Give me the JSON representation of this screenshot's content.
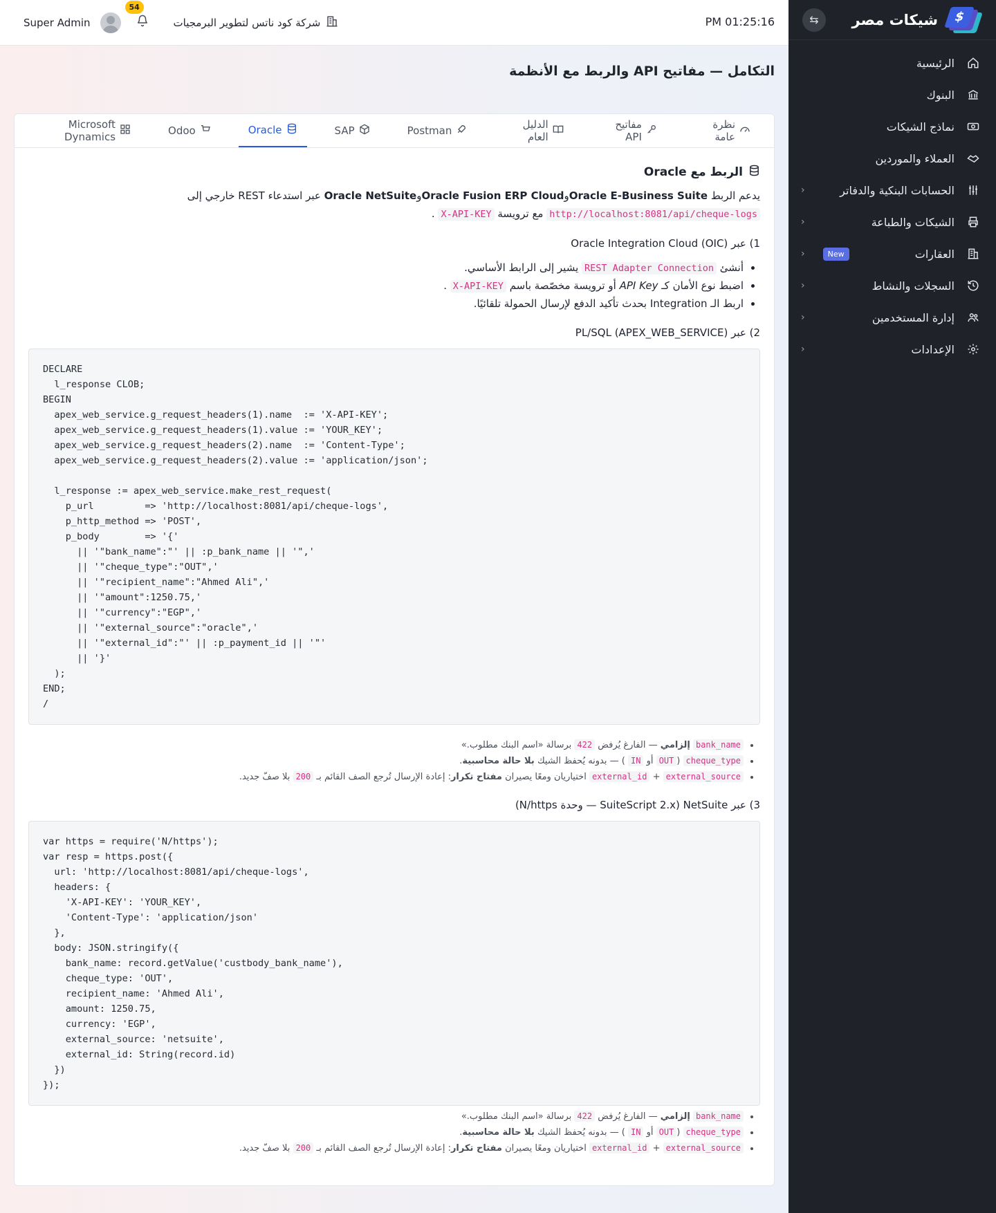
{
  "sidebar": {
    "brand": "شيكات مصر",
    "logo_glyph": "$",
    "items": [
      {
        "label": "الرئيسية",
        "icon": "home-icon"
      },
      {
        "label": "البنوك",
        "icon": "bank-icon"
      },
      {
        "label": "نماذج الشيكات",
        "icon": "cheque-icon"
      },
      {
        "label": "العملاء والموردين",
        "icon": "handshake-icon"
      },
      {
        "label": "الحسابات البنكية والدفاتر",
        "icon": "sliders-icon"
      },
      {
        "label": "الشيكات والطباعة",
        "icon": "printer-icon"
      },
      {
        "label": "العقارات",
        "icon": "building-icon",
        "badge": "New"
      },
      {
        "label": "السجلات والنشاط",
        "icon": "history-icon"
      },
      {
        "label": "إدارة المستخدمين",
        "icon": "users-icon"
      },
      {
        "label": "الإعدادات",
        "icon": "gear-icon"
      }
    ]
  },
  "topbar": {
    "time": "PM 01:25:16",
    "company": "شركة كود ناتس لتطوير البرمجيات",
    "notifications": "54",
    "user": "Super Admin"
  },
  "page": {
    "title": "التكامل — مفاتيح API والربط مع الأنظمة"
  },
  "tabs": [
    {
      "label": "نظرة عامة",
      "icon": "gauge-icon"
    },
    {
      "label": "مفاتيح API",
      "icon": "key-icon"
    },
    {
      "label": "الدليل العام",
      "icon": "book-icon"
    },
    {
      "label": "Postman",
      "icon": "rocket-icon"
    },
    {
      "label": "SAP",
      "icon": "box-icon"
    },
    {
      "label": "Oracle",
      "icon": "database-icon",
      "active": true
    },
    {
      "label": "Odoo",
      "icon": "cart-icon"
    },
    {
      "label": "Microsoft Dynamics",
      "icon": "grid-icon"
    }
  ],
  "oracle": {
    "title": "الربط مع Oracle",
    "intro_prefix": "يدعم الربط",
    "ebs": "Oracle E-Business Suite",
    "and1": "و",
    "fusion": "Oracle Fusion ERP Cloud",
    "and2": "و",
    "netsuite": "Oracle NetSuite",
    "intro_mid": "عبر استدعاء REST خارجي إلى",
    "endpoint": "http://localhost:8081/api/cheque-logs",
    "intro_header": "مع ترويسة",
    "api_key_header": "X-API-KEY",
    "intro_end": ".",
    "step1": "1) عبر Oracle Integration Cloud (OIC)",
    "step1_b1_pre": "أنشئ",
    "step1_b1_code": "REST Adapter Connection",
    "step1_b1_post": "يشير إلى الرابط الأساسي.",
    "step1_b2_pre": "اضبط نوع الأمان كـ",
    "step1_b2_em": "API Key",
    "step1_b2_mid": "أو ترويسة مخصّصة باسم",
    "step1_b2_code": "X-API-KEY",
    "step1_b2_post": ".",
    "step1_b3": "اربط الـ Integration بحدث تأكيد الدفع لإرسال الحمولة تلقائيًا.",
    "step2": "2) عبر PL/SQL (APEX_WEB_SERVICE)",
    "plsql_code": "DECLARE\n  l_response CLOB;\nBEGIN\n  apex_web_service.g_request_headers(1).name  := 'X-API-KEY';\n  apex_web_service.g_request_headers(1).value := 'YOUR_KEY';\n  apex_web_service.g_request_headers(2).name  := 'Content-Type';\n  apex_web_service.g_request_headers(2).value := 'application/json';\n\n  l_response := apex_web_service.make_rest_request(\n    p_url         => 'http://localhost:8081/api/cheque-logs',\n    p_http_method => 'POST',\n    p_body        => '{'\n      || '\"bank_name\":\"' || :p_bank_name || '\",'\n      || '\"cheque_type\":\"OUT\",'\n      || '\"recipient_name\":\"Ahmed Ali\",'\n      || '\"amount\":1250.75,'\n      || '\"currency\":\"EGP\",'\n      || '\"external_source\":\"oracle\",'\n      || '\"external_id\":\"' || :p_payment_id || '\"'\n      || '}'\n  );\nEND;\n/",
    "step3": "3) عبر NetSuite (SuiteScript 2.x — وحدة N/https)",
    "netsuite_code": "var https = require('N/https');\nvar resp = https.post({\n  url: 'http://localhost:8081/api/cheque-logs',\n  headers: {\n    'X-API-KEY': 'YOUR_KEY',\n    'Content-Type': 'application/json'\n  },\n  body: JSON.stringify({\n    bank_name: record.getValue('custbody_bank_name'),\n    cheque_type: 'OUT',\n    recipient_name: 'Ahmed Ali',\n    amount: 1250.75,\n    currency: 'EGP',\n    external_source: 'netsuite',\n    external_id: String(record.id)\n  })\n});"
  },
  "notes": {
    "n1_code": "bank_name",
    "n1_bold": "إلزامي",
    "n1_mid": "— الفارغ يُرفض",
    "n1_status": "422",
    "n1_post": "برسالة «اسم البنك مطلوب.»",
    "n2_code": "cheque_type",
    "n2_open": "(",
    "n2_out": "OUT",
    "n2_or": "أو",
    "n2_in": "IN",
    "n2_mid": ") — بدونه يُحفظ الشيك",
    "n2_bold": "بلا حالة محاسبية",
    "n2_end": ".",
    "n3_code1": "external_id",
    "n3_plus": "+",
    "n3_code2": "external_source",
    "n3_mid": "اختياريان ومعًا يصيران",
    "n3_bold": "مفتاح تكرار",
    "n3_mid2": ": إعادة الإرسال تُرجع الصف القائم بـ",
    "n3_status": "200",
    "n3_end": "بلا صفّ جديد."
  }
}
